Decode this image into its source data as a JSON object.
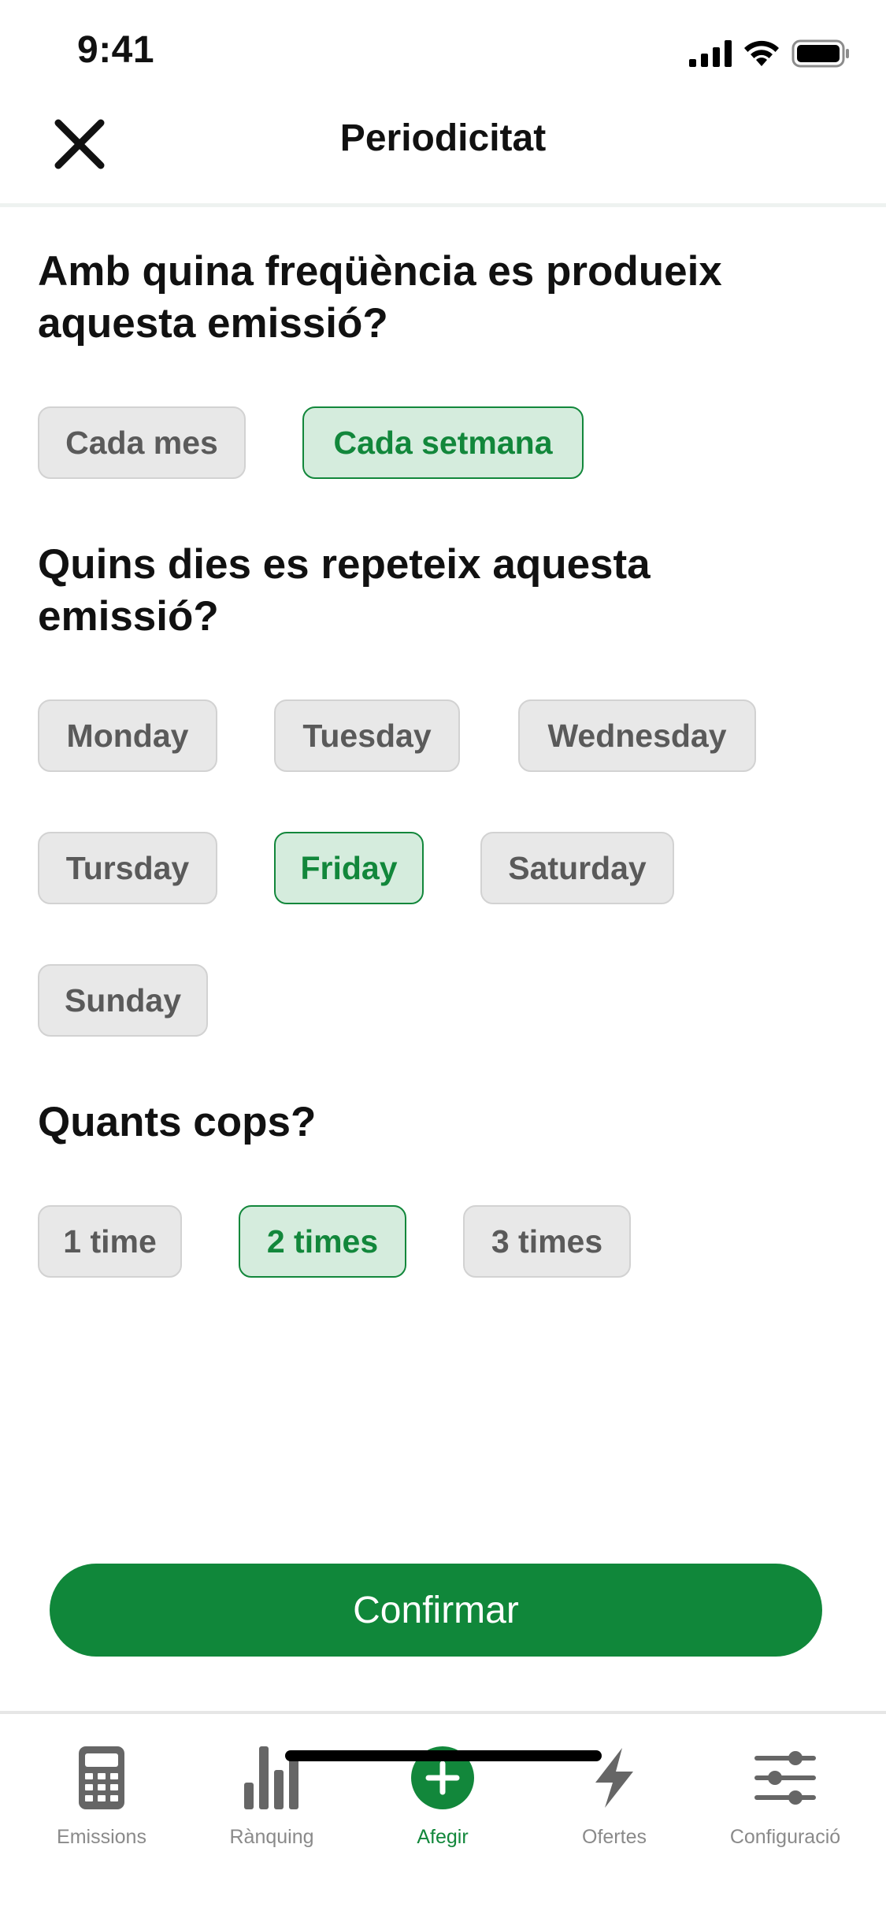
{
  "status_bar": {
    "time": "9:41"
  },
  "header": {
    "title": "Periodicitat",
    "close_icon": "close-icon"
  },
  "frequency": {
    "question": "Amb quina freqüència es produeix aquesta emissió?",
    "options": [
      {
        "label": "Cada mes",
        "selected": false
      },
      {
        "label": "Cada setmana",
        "selected": true
      }
    ]
  },
  "days": {
    "question": "Quins dies es repeteix aquesta emissió?",
    "options": [
      {
        "label": "Monday",
        "selected": false
      },
      {
        "label": "Tuesday",
        "selected": false
      },
      {
        "label": "Wednesday",
        "selected": false
      },
      {
        "label": "Tursday",
        "selected": false
      },
      {
        "label": "Friday",
        "selected": true
      },
      {
        "label": "Saturday",
        "selected": false
      },
      {
        "label": "Sunday",
        "selected": false
      }
    ]
  },
  "times": {
    "question": "Quants cops?",
    "options": [
      {
        "label": "1 time",
        "selected": false
      },
      {
        "label": "2 times",
        "selected": true
      },
      {
        "label": "3 times",
        "selected": false
      }
    ]
  },
  "confirm_label": "Confirmar",
  "tab_bar": {
    "items": [
      {
        "label": "Emissions",
        "icon": "calculator-icon",
        "active": false
      },
      {
        "label": "Rànquing",
        "icon": "bar-chart-icon",
        "active": false
      },
      {
        "label": "Afegir",
        "icon": "add-circle-icon",
        "active": true
      },
      {
        "label": "Ofertes",
        "icon": "lightning-icon",
        "active": false
      },
      {
        "label": "Configuració",
        "icon": "sliders-icon",
        "active": false
      }
    ]
  },
  "colors": {
    "accent": "#12873b",
    "accent_bg": "#d5ecdd",
    "chip_bg": "#e8e8e8",
    "chip_text": "#5a5a5a"
  }
}
